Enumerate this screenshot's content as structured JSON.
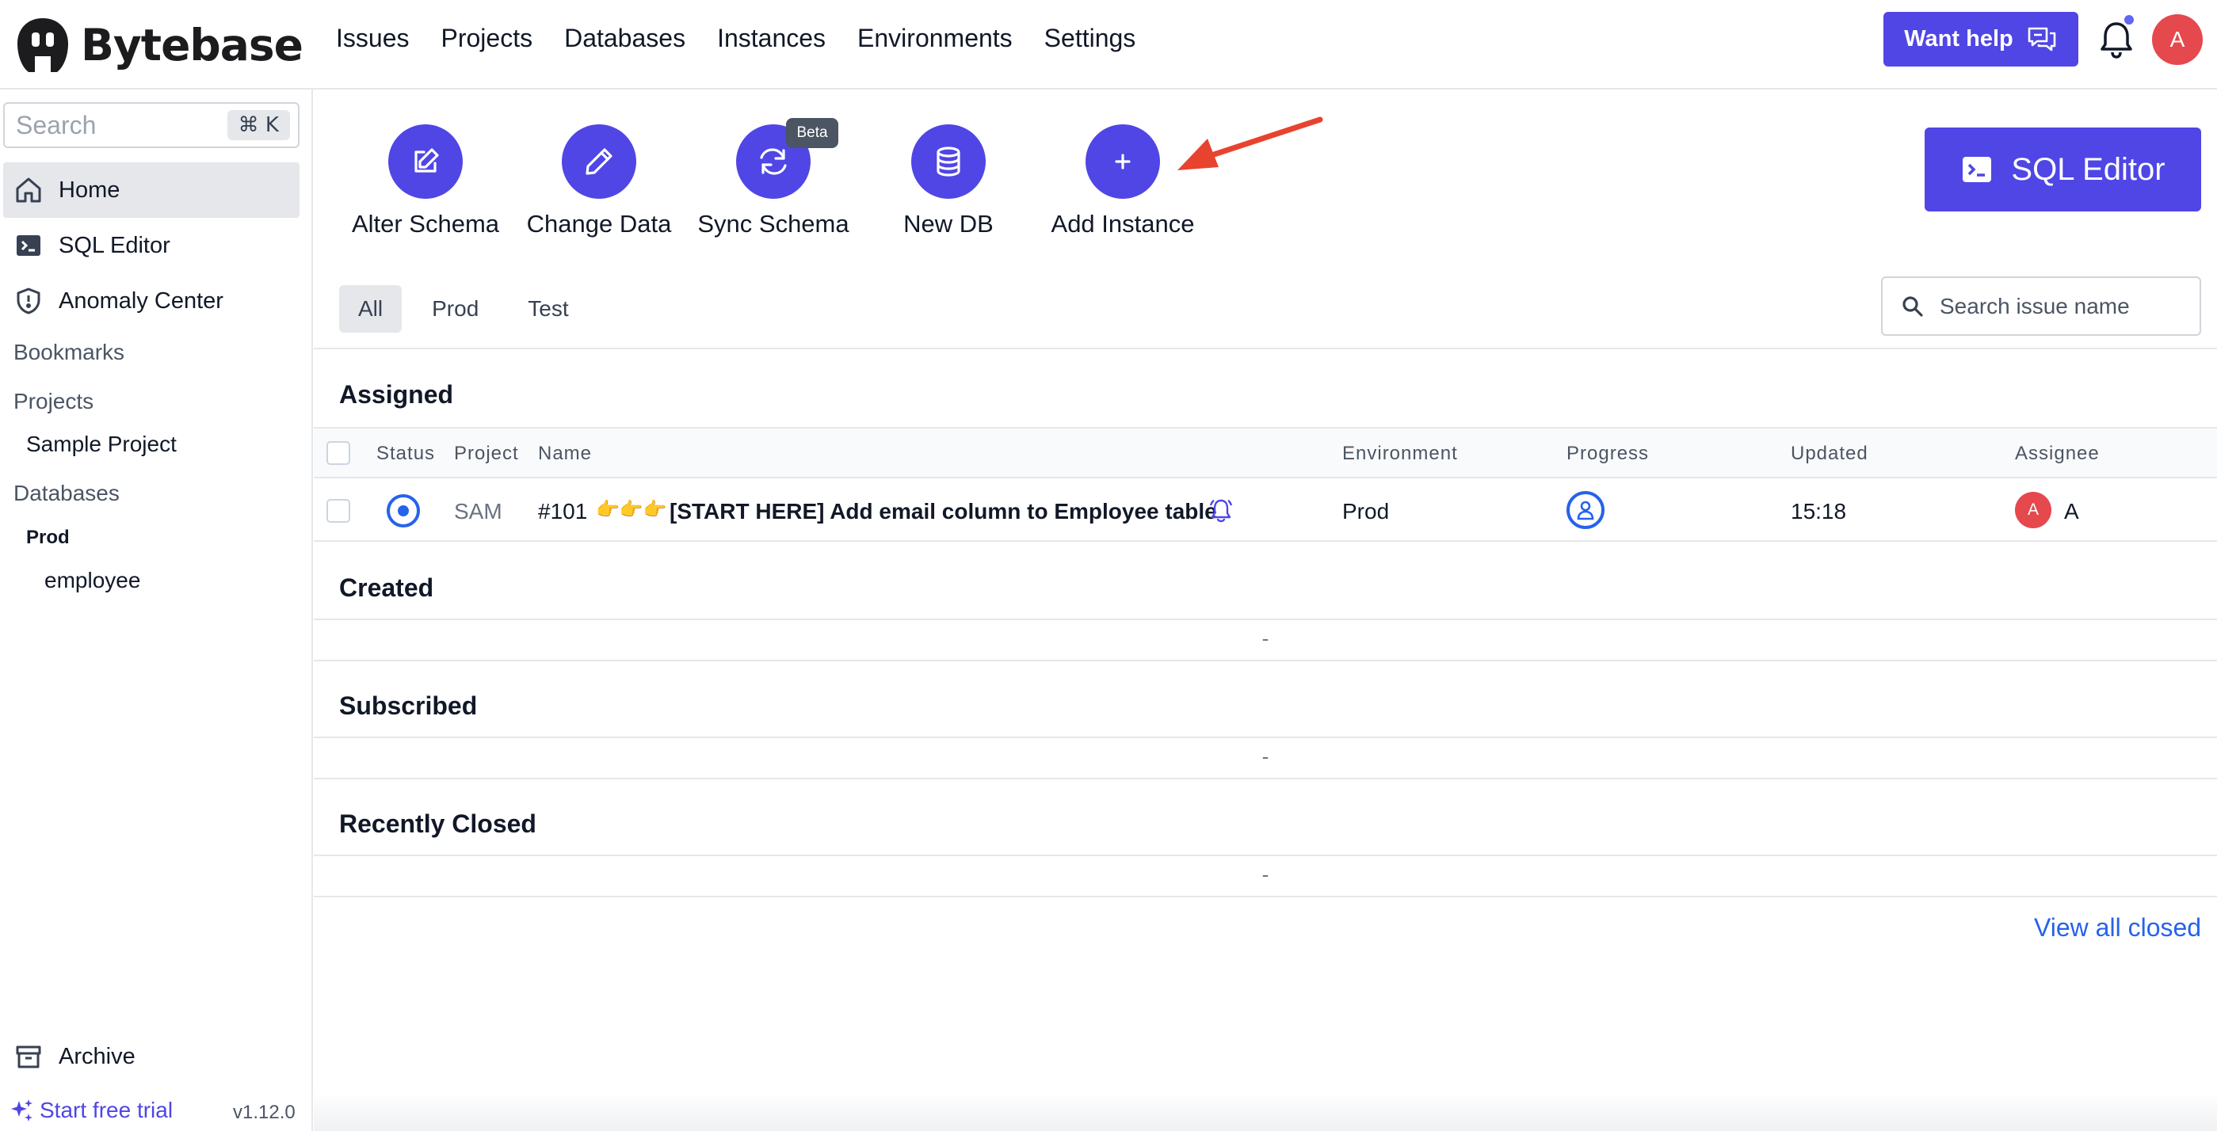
{
  "app": {
    "brand": "Bytebase",
    "nav": [
      "Issues",
      "Projects",
      "Databases",
      "Instances",
      "Environments",
      "Settings"
    ],
    "help_label": "Want help",
    "avatar_initial": "A",
    "colors": {
      "primary": "#4f46e5",
      "link": "#2563eb",
      "avatar": "#e5484d"
    }
  },
  "sidebar": {
    "search_placeholder": "Search",
    "shortcut": "⌘ K",
    "items": [
      {
        "label": "Home",
        "icon": "home-icon"
      },
      {
        "label": "SQL Editor",
        "icon": "terminal-icon"
      },
      {
        "label": "Anomaly Center",
        "icon": "shield-icon"
      }
    ],
    "bookmarks_label": "Bookmarks",
    "projects_label": "Projects",
    "projects": [
      "Sample Project"
    ],
    "databases_label": "Databases",
    "env_group": "Prod",
    "databases": [
      "employee"
    ],
    "archive_label": "Archive",
    "trial_label": "Start free trial",
    "version": "v1.12.0"
  },
  "quick_actions": [
    {
      "label": "Alter Schema",
      "icon": "edit-icon"
    },
    {
      "label": "Change Data",
      "icon": "pencil-icon"
    },
    {
      "label": "Sync Schema",
      "icon": "refresh-icon"
    },
    {
      "label": "New DB",
      "icon": "database-icon"
    },
    {
      "label": "Add Instance",
      "icon": "plus-icon"
    }
  ],
  "beta_badge": "Beta",
  "sql_editor_button": "SQL Editor",
  "env_tabs": [
    "All",
    "Prod",
    "Test"
  ],
  "issue_search_placeholder": "Search issue name",
  "sections": {
    "assigned": "Assigned",
    "created": "Created",
    "subscribed": "Subscribed",
    "recently_closed": "Recently Closed"
  },
  "table": {
    "columns": [
      "Status",
      "Project",
      "Name",
      "Environment",
      "Progress",
      "Updated",
      "Assignee"
    ],
    "rows": [
      {
        "project": "SAM",
        "id": "#101",
        "emoji": "👉👉👉",
        "name": "[START HERE] Add email column to Employee table",
        "environment": "Prod",
        "updated": "15:18",
        "assignee_initial": "A",
        "assignee": "A"
      }
    ]
  },
  "empty_placeholder": "-",
  "view_all_closed": "View all closed"
}
